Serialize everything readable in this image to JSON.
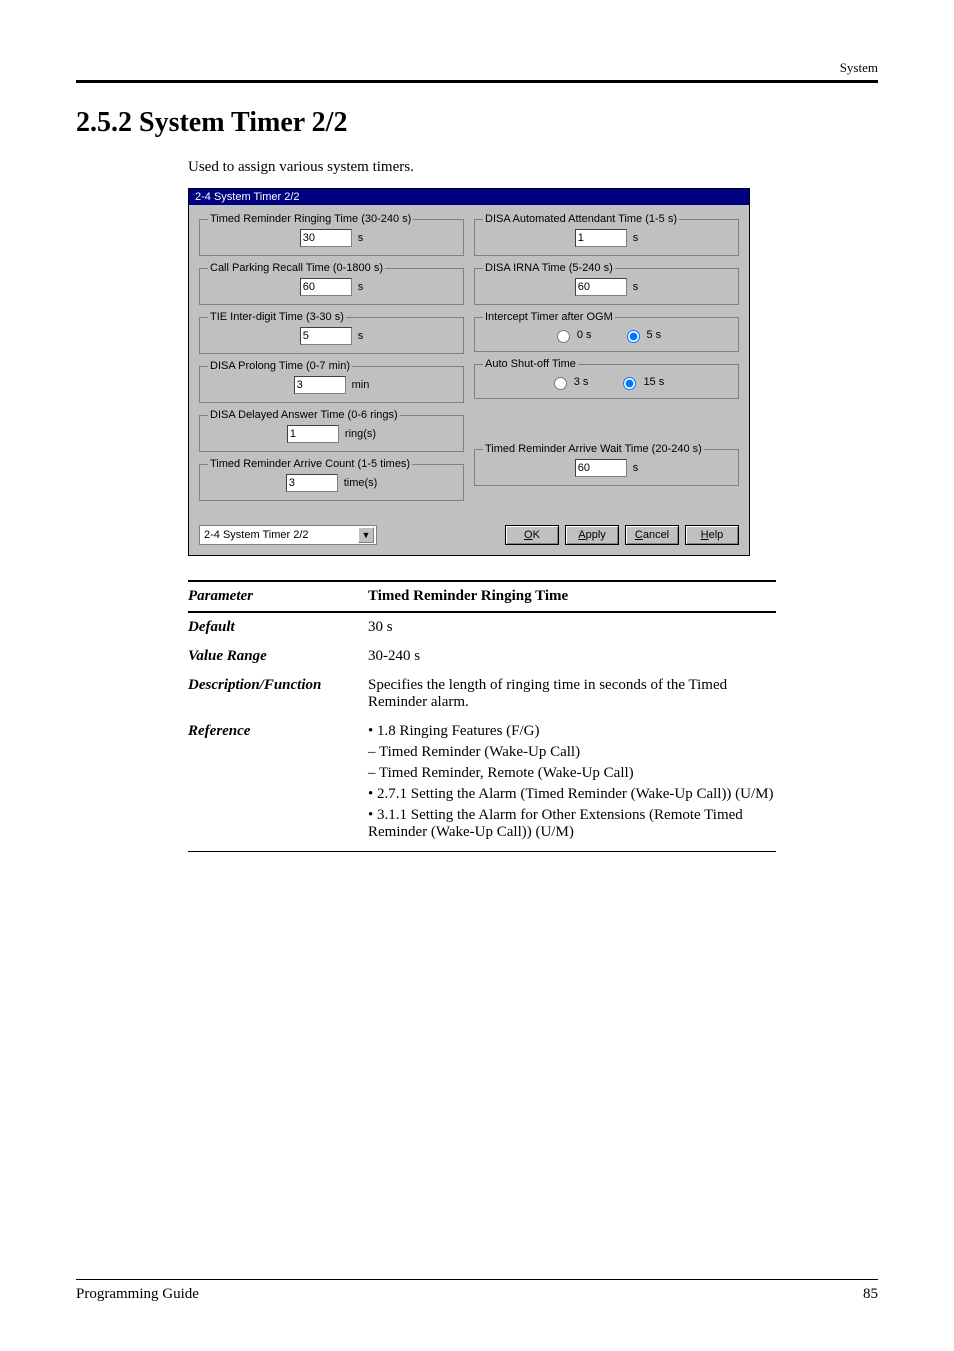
{
  "header": {
    "section": "System"
  },
  "title": "2.5.2   System Timer 2/2",
  "intro": "Used to assign various system timers.",
  "dialog": {
    "title": "2-4 System Timer 2/2",
    "left": {
      "g1": {
        "legend": "Timed Reminder Ringing Time (30-240 s)",
        "value": "30",
        "unit": "s"
      },
      "g2": {
        "legend": "Call Parking Recall Time (0-1800 s)",
        "value": "60",
        "unit": "s"
      },
      "g3": {
        "legend": "TIE Inter-digit Time (3-30 s)",
        "value": "5",
        "unit": "s"
      },
      "g4": {
        "legend": "DISA Prolong Time (0-7 min)",
        "value": "3",
        "unit": "min"
      },
      "g5": {
        "legend": "DISA Delayed Answer Time (0-6 rings)",
        "value": "1",
        "unit": "ring(s)"
      },
      "g6": {
        "legend": "Timed Reminder Arrive Count (1-5 times)",
        "value": "3",
        "unit": "time(s)"
      }
    },
    "right": {
      "g1": {
        "legend": "DISA Automated Attendant Time (1-5 s)",
        "value": "1",
        "unit": "s"
      },
      "g2": {
        "legend": "DISA IRNA Time (5-240 s)",
        "value": "60",
        "unit": "s"
      },
      "g3": {
        "legend": "Intercept Timer after OGM",
        "opt1": "0 s",
        "opt2": "5 s"
      },
      "g4": {
        "legend": "Auto Shut-off Time",
        "opt1": "3 s",
        "opt2": "15 s"
      },
      "g6": {
        "legend": "Timed Reminder Arrive Wait Time (20-240 s)",
        "value": "60",
        "unit": "s"
      }
    },
    "combo": "2-4 System Timer 2/2",
    "buttons": {
      "ok": "OK",
      "apply": "Apply",
      "cancel": "Cancel",
      "help": "Help"
    },
    "ul": {
      "ok": "O",
      "apply": "A",
      "cancel": "C",
      "help": "H"
    }
  },
  "table": {
    "head_left": "Parameter",
    "head_right": "Timed Reminder Ringing Time",
    "rows": {
      "default_label": "Default",
      "default_value": "30 s",
      "range_label": "Value Range",
      "range_value": "30-240 s",
      "desc_label": "Description/Function",
      "desc_value": "Specifies the length of ringing time in seconds of the Timed Reminder alarm.",
      "ref_label": "Reference",
      "ref_lines": {
        "l1": "• 1.8 Ringing Features (F/G)",
        "l2": "– Timed Reminder (Wake-Up Call)",
        "l3": "– Timed Reminder, Remote (Wake-Up Call)",
        "l4": "• 2.7.1 Setting the Alarm (Timed Reminder (Wake-Up Call)) (U/M)",
        "l5": "• 3.1.1 Setting the Alarm for Other Extensions (Remote Timed Reminder (Wake-Up Call)) (U/M)"
      }
    }
  },
  "footer": {
    "left": "Programming Guide",
    "right": "85"
  }
}
